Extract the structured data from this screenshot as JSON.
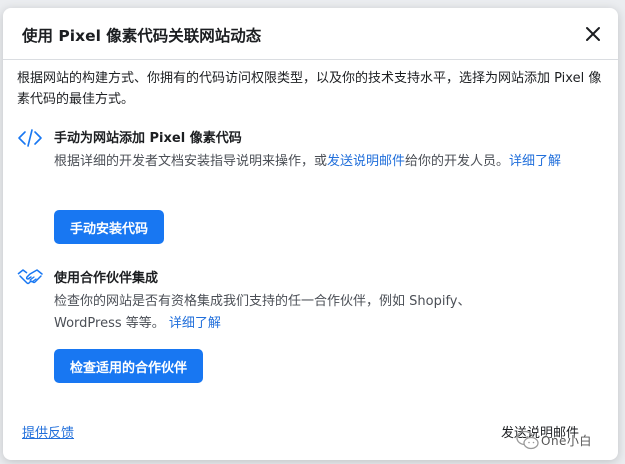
{
  "dialog": {
    "title": "使用 Pixel 像素代码关联网站动态",
    "close_icon": "close-icon"
  },
  "intro": {
    "text": "根据网站的构建方式、你拥有的代码访问权限类型，以及你的技术支持水平，选择为网站添加 Pixel 像素代码的最佳方式。"
  },
  "manual": {
    "icon": "code-icon",
    "title": "手动为网站添加 Pixel 像素代码",
    "body_before": "根据详细的开发者文档安装指导说明来操作，或",
    "link_send": "发送说明邮件",
    "body_after": "给你的开发人员。",
    "link_learn": "详细了解",
    "button": "手动安装代码"
  },
  "partner": {
    "icon": "handshake-icon",
    "title": "使用合作伙伴集成",
    "body": "检查你的网站是否有资格集成我们支持的任一合作伙伴，例如 Shopify、WordPress 等等。",
    "link_learn": "详细了解",
    "button": "检查适用的合作伙伴"
  },
  "footer": {
    "feedback": "提供反馈",
    "send": "发送说明邮件"
  },
  "watermark": {
    "text": "One小白"
  },
  "colors": {
    "accent": "#1877f2",
    "link": "#216fdb"
  }
}
